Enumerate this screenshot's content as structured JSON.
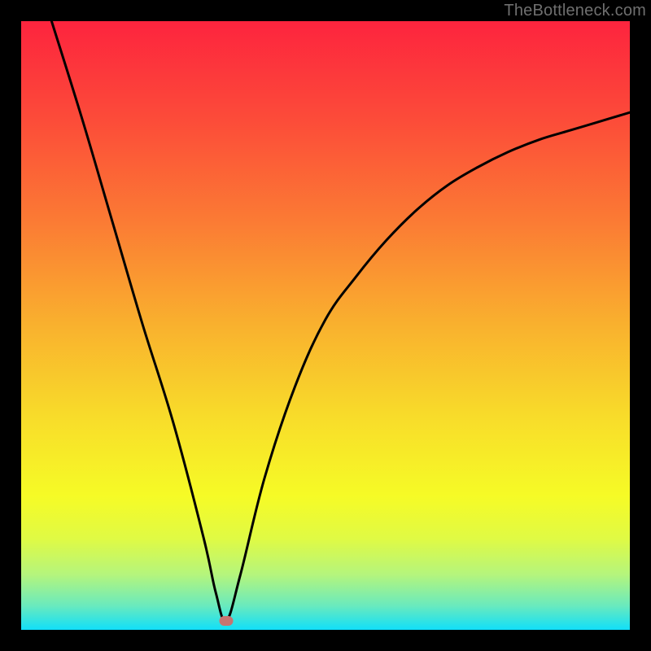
{
  "watermark": "TheBottleneck.com",
  "colors": {
    "frame": "#000000",
    "gradient_stops": [
      {
        "pos": 0.0,
        "color": "#fd243e"
      },
      {
        "pos": 0.16,
        "color": "#fc4b39"
      },
      {
        "pos": 0.33,
        "color": "#fb7b34"
      },
      {
        "pos": 0.5,
        "color": "#f9b12e"
      },
      {
        "pos": 0.65,
        "color": "#f8dc2a"
      },
      {
        "pos": 0.78,
        "color": "#f6fb26"
      },
      {
        "pos": 0.85,
        "color": "#e0fa44"
      },
      {
        "pos": 0.91,
        "color": "#b4f57d"
      },
      {
        "pos": 0.96,
        "color": "#6aeabd"
      },
      {
        "pos": 1.0,
        "color": "#11dff9"
      }
    ],
    "curve": "#000000",
    "marker": "#c77471"
  },
  "marker": {
    "x_frac": 0.337,
    "y_frac": 0.985
  },
  "chart_data": {
    "type": "line",
    "title": "",
    "xlabel": "",
    "ylabel": "",
    "xlim": [
      0,
      100
    ],
    "ylim": [
      0,
      100
    ],
    "series": [
      {
        "name": "bottleneck-curve",
        "x": [
          5,
          10,
          15,
          20,
          25,
          30,
          32,
          33.7,
          36,
          40,
          45,
          50,
          55,
          60,
          65,
          70,
          75,
          80,
          85,
          90,
          95,
          100
        ],
        "y": [
          100,
          84,
          67,
          50,
          34,
          15,
          6,
          1.5,
          9,
          25,
          40,
          51,
          58,
          64,
          69,
          73,
          76,
          78.5,
          80.5,
          82,
          83.5,
          85
        ]
      }
    ],
    "annotations": [
      {
        "type": "watermark",
        "text": "TheBottleneck.com",
        "position": "top-right"
      },
      {
        "type": "marker",
        "label": "optimal-point",
        "x": 33.7,
        "y": 1.5
      }
    ]
  }
}
